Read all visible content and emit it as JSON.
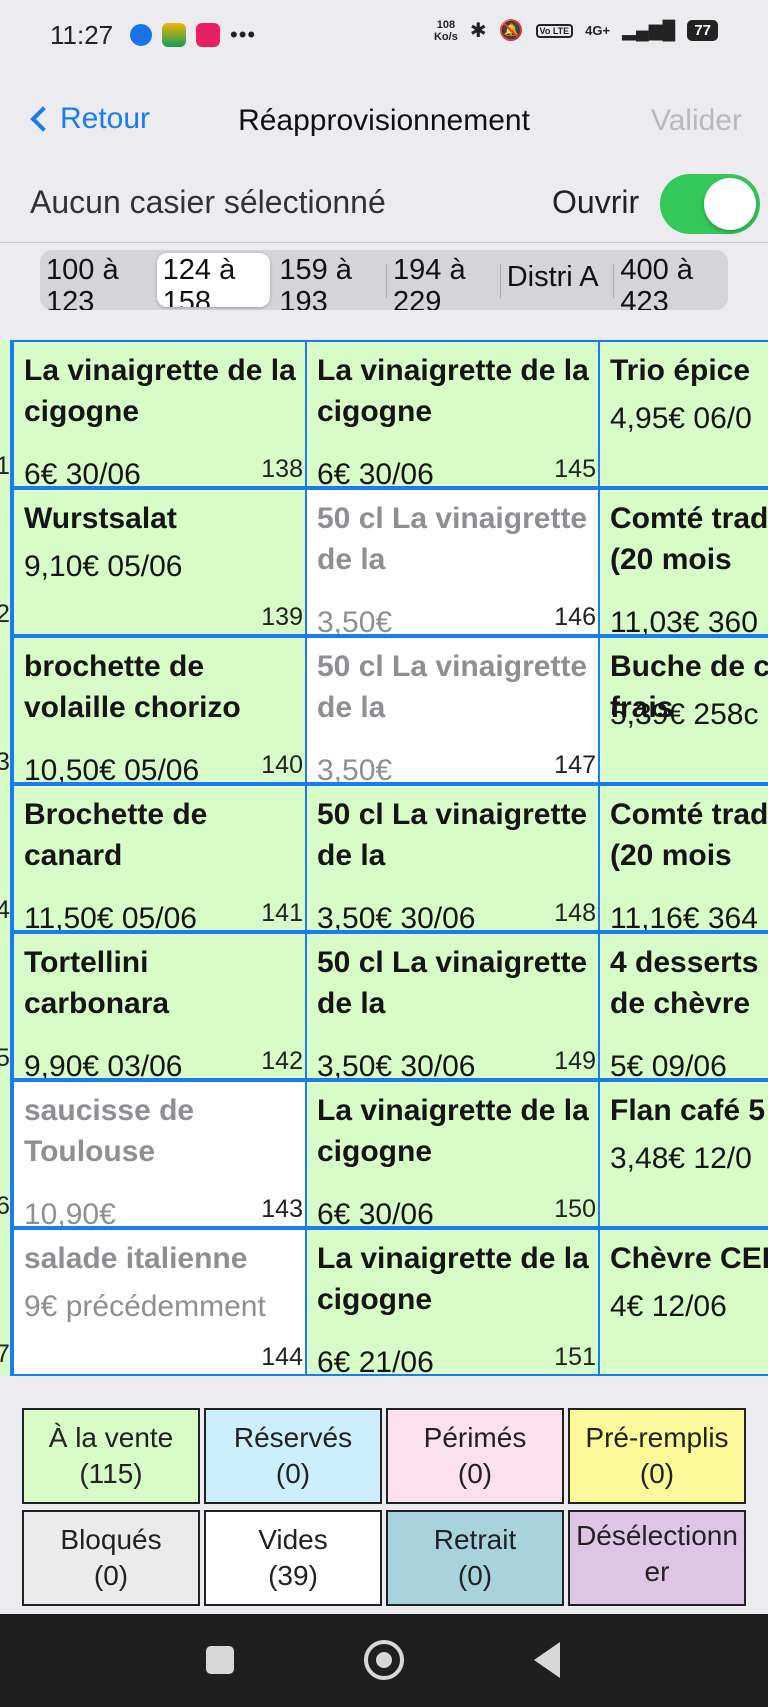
{
  "status_bar": {
    "time": "11:27",
    "speed_value": "108",
    "speed_unit": "Ko/s",
    "volte": "Vo LTE",
    "network": "4G+",
    "battery": "77"
  },
  "nav": {
    "back_label": "Retour",
    "title": "Réapprovisionnement",
    "validate_label": "Valider"
  },
  "selection": {
    "text": "Aucun casier sélectionné",
    "open_label": "Ouvrir",
    "open_toggle_on": true
  },
  "segments": [
    {
      "line1": "100 à",
      "line2": "123"
    },
    {
      "line1": "124 à",
      "line2": "158"
    },
    {
      "line1": "159 à",
      "line2": "193"
    },
    {
      "line1": "194 à",
      "line2": "229"
    },
    {
      "line1": "Distri A",
      "line2": ""
    },
    {
      "line1": "400 à",
      "line2": "423"
    }
  ],
  "active_segment": 1,
  "left_column_numbers": [
    "1",
    "2",
    "3",
    "4",
    "5",
    "6",
    "7"
  ],
  "lockers": {
    "col1": [
      {
        "name": "La vinaigrette de la cigogne",
        "price": "6€ 30/06",
        "number": "138",
        "state": "green"
      },
      {
        "name": "Wurstsalat",
        "price": "9,10€ 05/06",
        "number": "139",
        "state": "green"
      },
      {
        "name": "brochette de volaille chorizo",
        "price": "10,50€ 05/06",
        "number": "140",
        "state": "green"
      },
      {
        "name": "Brochette de canard",
        "price": "11,50€ 05/06",
        "number": "141",
        "state": "green"
      },
      {
        "name": "Tortellini carbonara",
        "price": "9,90€ 03/06",
        "number": "142",
        "state": "green"
      },
      {
        "name": "saucisse de Toulouse",
        "price": "10,90€",
        "number": "143",
        "state": "white"
      },
      {
        "name": "salade italienne",
        "price": "9€ précédemment",
        "number": "144",
        "state": "white"
      }
    ],
    "col2": [
      {
        "name": "La vinaigrette de la cigogne",
        "price": "6€ 30/06",
        "number": "145",
        "state": "green"
      },
      {
        "name": "50 cl La vinaigrette de la",
        "price": "3,50€",
        "number": "146",
        "state": "white"
      },
      {
        "name": "50 cl La vinaigrette de la",
        "price": "3,50€",
        "number": "147",
        "state": "white"
      },
      {
        "name": "50 cl La vinaigrette de la",
        "price": "3,50€ 30/06",
        "number": "148",
        "state": "green"
      },
      {
        "name": "50 cl La vinaigrette de la",
        "price": "3,50€ 30/06",
        "number": "149",
        "state": "green"
      },
      {
        "name": "La vinaigrette de la cigogne",
        "price": "6€ 30/06",
        "number": "150",
        "state": "green"
      },
      {
        "name": "La vinaigrette de la cigogne",
        "price": "6€ 21/06",
        "number": "151",
        "state": "green"
      }
    ],
    "col3": [
      {
        "name": "Trio épice",
        "price": "4,95€ 06/0",
        "number": "",
        "state": "green"
      },
      {
        "name": "Comté trad (20 mois",
        "price": "11,03€ 360",
        "number": "",
        "state": "green"
      },
      {
        "name": "Buche de c frais",
        "price": "5,39€ 258c",
        "number": "",
        "state": "green"
      },
      {
        "name": "Comté trad (20 mois",
        "price": "11,16€ 364",
        "number": "",
        "state": "green"
      },
      {
        "name": "4 desserts de chèvre",
        "price": "5€ 09/06",
        "number": "",
        "state": "green"
      },
      {
        "name": "Flan café 5",
        "price": "3,48€ 12/0",
        "number": "",
        "state": "green"
      },
      {
        "name": "Chèvre CEI",
        "price": "4€ 12/06",
        "number": "",
        "state": "green"
      }
    ]
  },
  "filters": [
    {
      "label": "À la vente",
      "count": "(115)",
      "color": "#d7fcc8"
    },
    {
      "label": "Réservés",
      "count": "(0)",
      "color": "#cdeefc"
    },
    {
      "label": "Périmés",
      "count": "(0)",
      "color": "#fde0ee"
    },
    {
      "label": "Pré-remplis",
      "count": "(0)",
      "color": "#fbf99a"
    },
    {
      "label": "Bloqués",
      "count": "(0)",
      "color": "#ebebeb"
    },
    {
      "label": "Vides",
      "count": "(39)",
      "color": "#ffffff"
    },
    {
      "label": "Retrait",
      "count": "(0)",
      "color": "#a9d3dc"
    },
    {
      "label": "Désélectionner",
      "count": "",
      "color": "#dcc6e4"
    }
  ]
}
